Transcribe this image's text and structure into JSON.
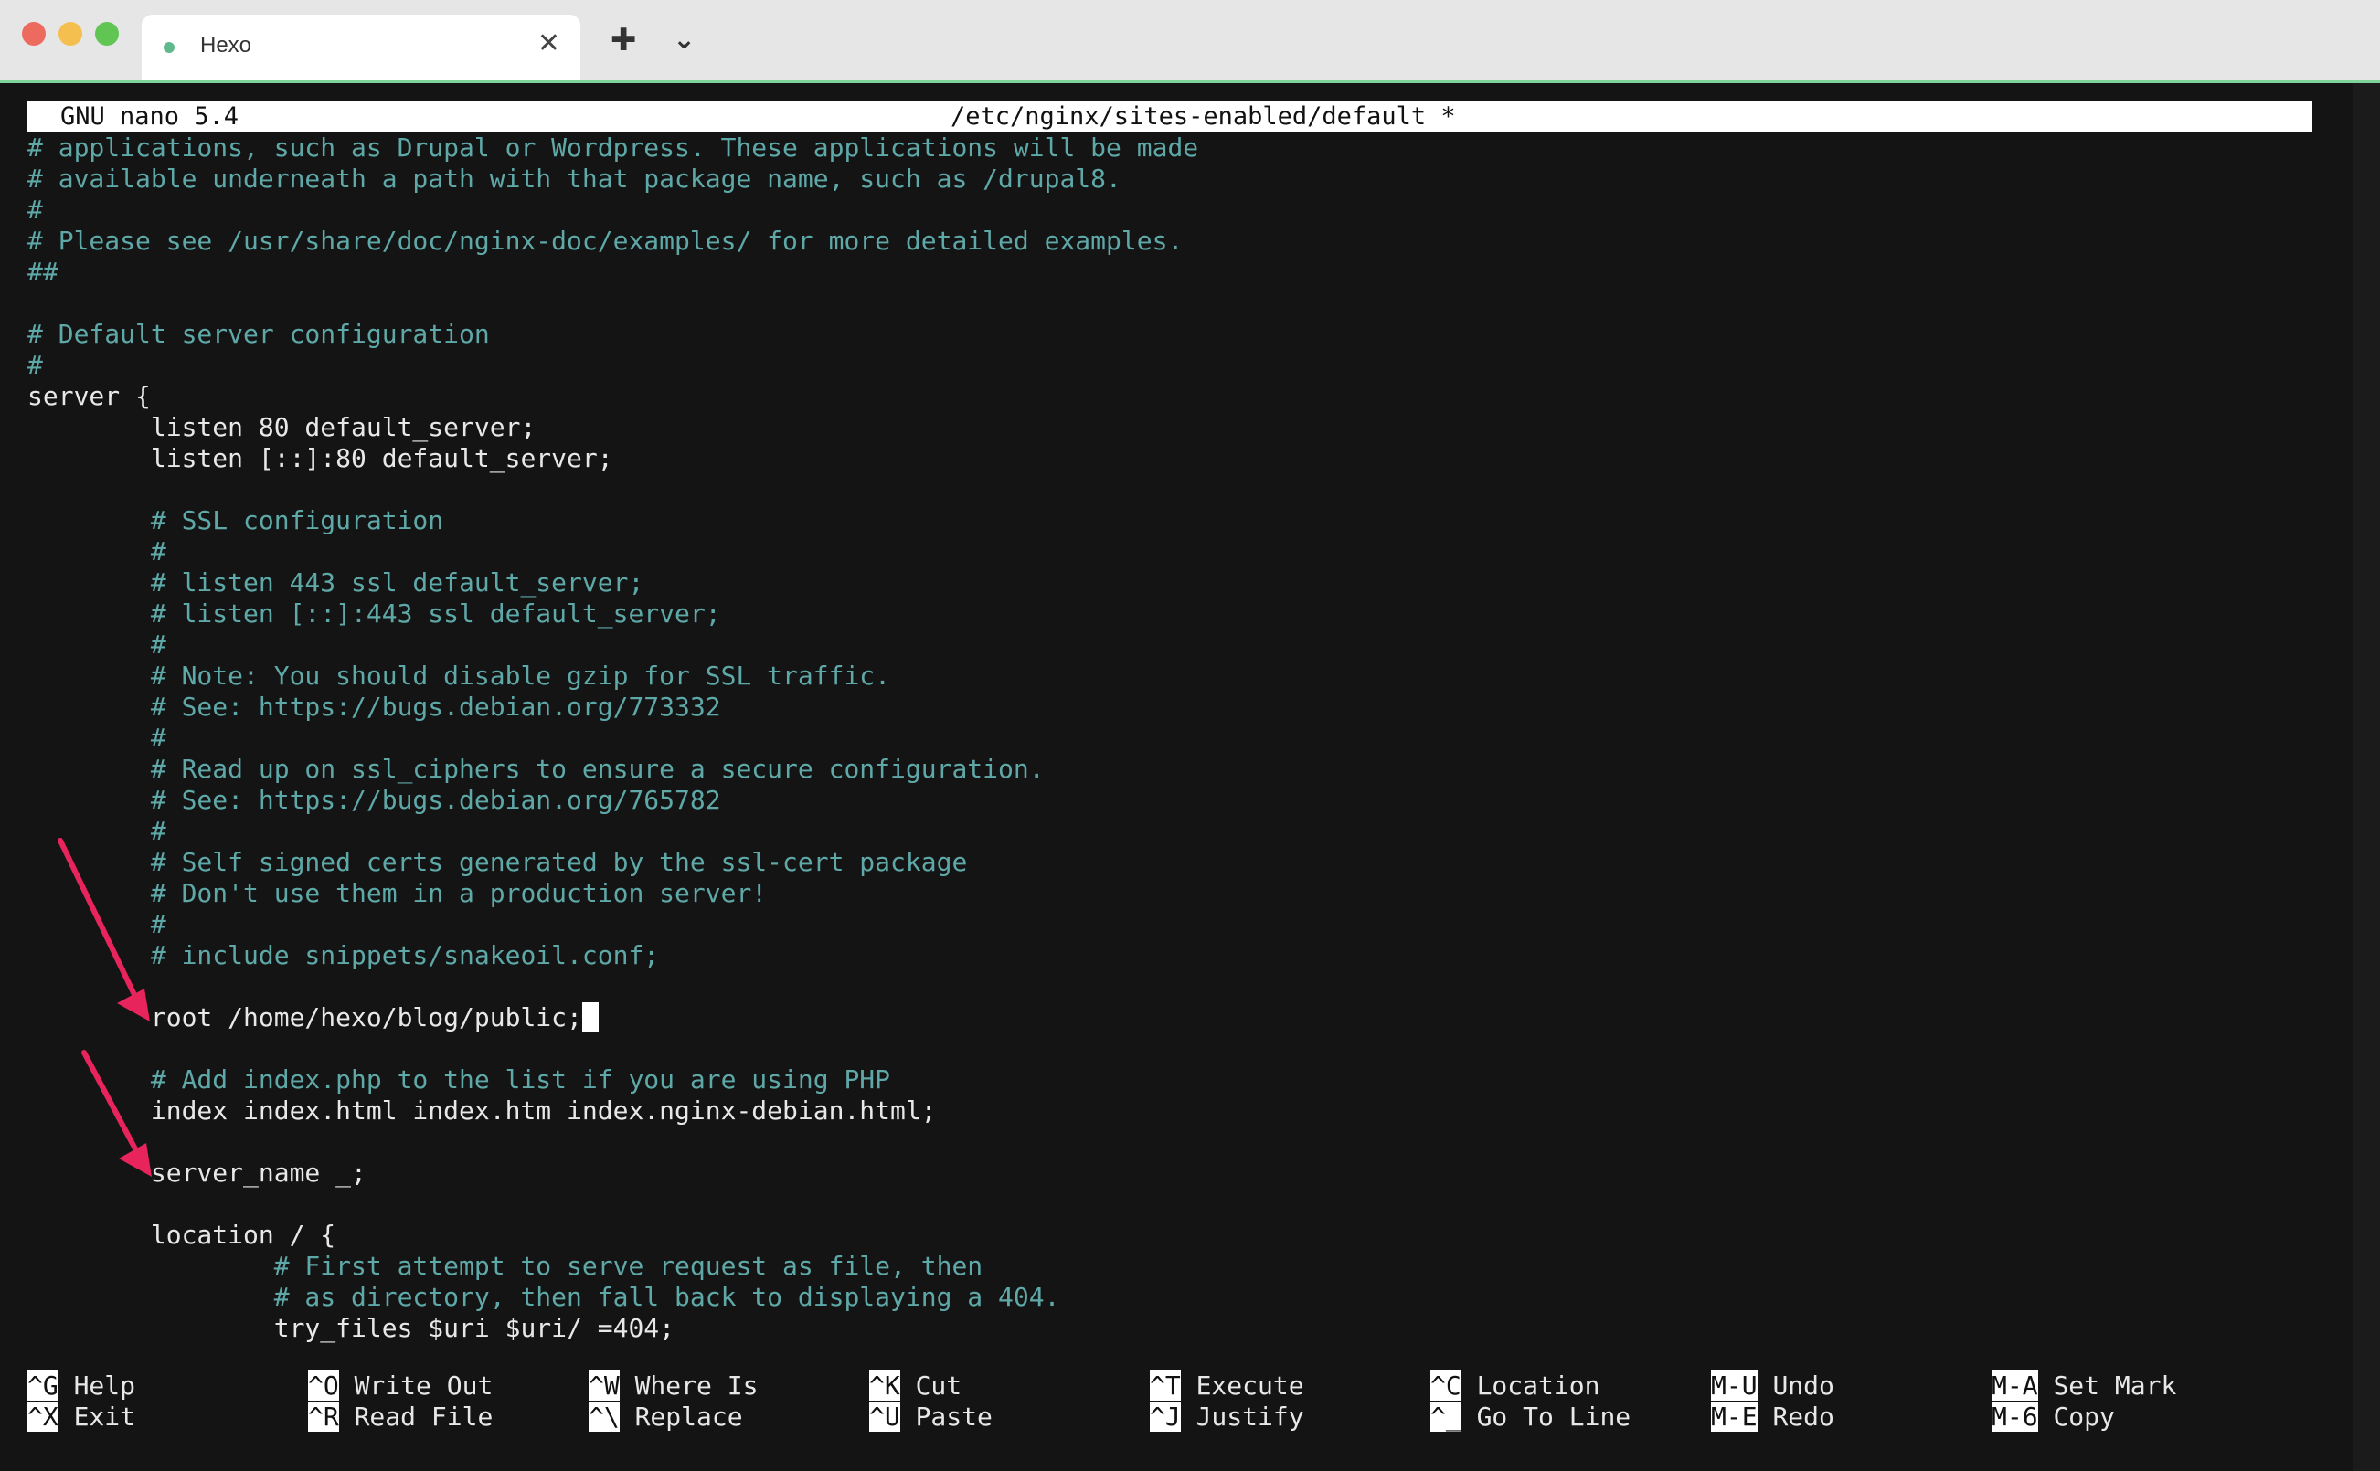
{
  "window": {
    "tab_title": "Hexo",
    "tab_close": "✕",
    "new_tab": "✚",
    "tab_menu": "⌄"
  },
  "nano": {
    "version": "GNU nano 5.4",
    "file": "/etc/nginx/sites-enabled/default *"
  },
  "lines": [
    {
      "text": "# applications, such as Drupal or Wordpress. These applications will be made",
      "kind": "comment"
    },
    {
      "text": "# available underneath a path with that package name, such as /drupal8.",
      "kind": "comment"
    },
    {
      "text": "#",
      "kind": "comment"
    },
    {
      "text": "# Please see /usr/share/doc/nginx-doc/examples/ for more detailed examples.",
      "kind": "comment"
    },
    {
      "text": "##",
      "kind": "comment"
    },
    {
      "text": "",
      "kind": "code"
    },
    {
      "text": "# Default server configuration",
      "kind": "comment"
    },
    {
      "text": "#",
      "kind": "comment"
    },
    {
      "text": "server {",
      "kind": "code"
    },
    {
      "text": "        listen 80 default_server;",
      "kind": "code"
    },
    {
      "text": "        listen [::]:80 default_server;",
      "kind": "code"
    },
    {
      "text": "",
      "kind": "code"
    },
    {
      "text": "        # SSL configuration",
      "kind": "comment"
    },
    {
      "text": "        #",
      "kind": "comment"
    },
    {
      "text": "        # listen 443 ssl default_server;",
      "kind": "comment"
    },
    {
      "text": "        # listen [::]:443 ssl default_server;",
      "kind": "comment"
    },
    {
      "text": "        #",
      "kind": "comment"
    },
    {
      "text": "        # Note: You should disable gzip for SSL traffic.",
      "kind": "comment"
    },
    {
      "text": "        # See: https://bugs.debian.org/773332",
      "kind": "comment"
    },
    {
      "text": "        #",
      "kind": "comment"
    },
    {
      "text": "        # Read up on ssl_ciphers to ensure a secure configuration.",
      "kind": "comment"
    },
    {
      "text": "        # See: https://bugs.debian.org/765782",
      "kind": "comment"
    },
    {
      "text": "        #",
      "kind": "comment"
    },
    {
      "text": "        # Self signed certs generated by the ssl-cert package",
      "kind": "comment"
    },
    {
      "text": "        # Don't use them in a production server!",
      "kind": "comment"
    },
    {
      "text": "        #",
      "kind": "comment"
    },
    {
      "text": "        # include snippets/snakeoil.conf;",
      "kind": "comment"
    },
    {
      "text": "",
      "kind": "code"
    },
    {
      "text": "        root /home/hexo/blog/public;",
      "kind": "code",
      "cursor": true
    },
    {
      "text": "",
      "kind": "code"
    },
    {
      "text": "        # Add index.php to the list if you are using PHP",
      "kind": "comment"
    },
    {
      "text": "        index index.html index.htm index.nginx-debian.html;",
      "kind": "code"
    },
    {
      "text": "",
      "kind": "code"
    },
    {
      "text": "        server_name _;",
      "kind": "code"
    },
    {
      "text": "",
      "kind": "code"
    },
    {
      "text": "        location / {",
      "kind": "code"
    },
    {
      "text": "                # First attempt to serve request as file, then",
      "kind": "comment"
    },
    {
      "text": "                # as directory, then fall back to displaying a 404.",
      "kind": "comment"
    },
    {
      "text": "                try_files $uri $uri/ =404;",
      "kind": "code"
    }
  ],
  "shortcuts": [
    [
      {
        "key": "^G",
        "label": "Help"
      },
      {
        "key": "^X",
        "label": "Exit"
      }
    ],
    [
      {
        "key": "^O",
        "label": "Write Out"
      },
      {
        "key": "^R",
        "label": "Read File"
      }
    ],
    [
      {
        "key": "^W",
        "label": "Where Is"
      },
      {
        "key": "^\\",
        "label": "Replace"
      }
    ],
    [
      {
        "key": "^K",
        "label": "Cut"
      },
      {
        "key": "^U",
        "label": "Paste"
      }
    ],
    [
      {
        "key": "^T",
        "label": "Execute"
      },
      {
        "key": "^J",
        "label": "Justify"
      }
    ],
    [
      {
        "key": "^C",
        "label": "Location"
      },
      {
        "key": "^_",
        "label": "Go To Line"
      }
    ],
    [
      {
        "key": "M-U",
        "label": "Undo"
      },
      {
        "key": "M-E",
        "label": "Redo"
      }
    ],
    [
      {
        "key": "M-A",
        "label": "Set Mark"
      },
      {
        "key": "M-6",
        "label": "Copy"
      }
    ]
  ],
  "colors": {
    "terminal_bg": "#141414",
    "comment": "#5fa8a8",
    "code": "#e8e8e8",
    "arrow": "#e8245c"
  }
}
